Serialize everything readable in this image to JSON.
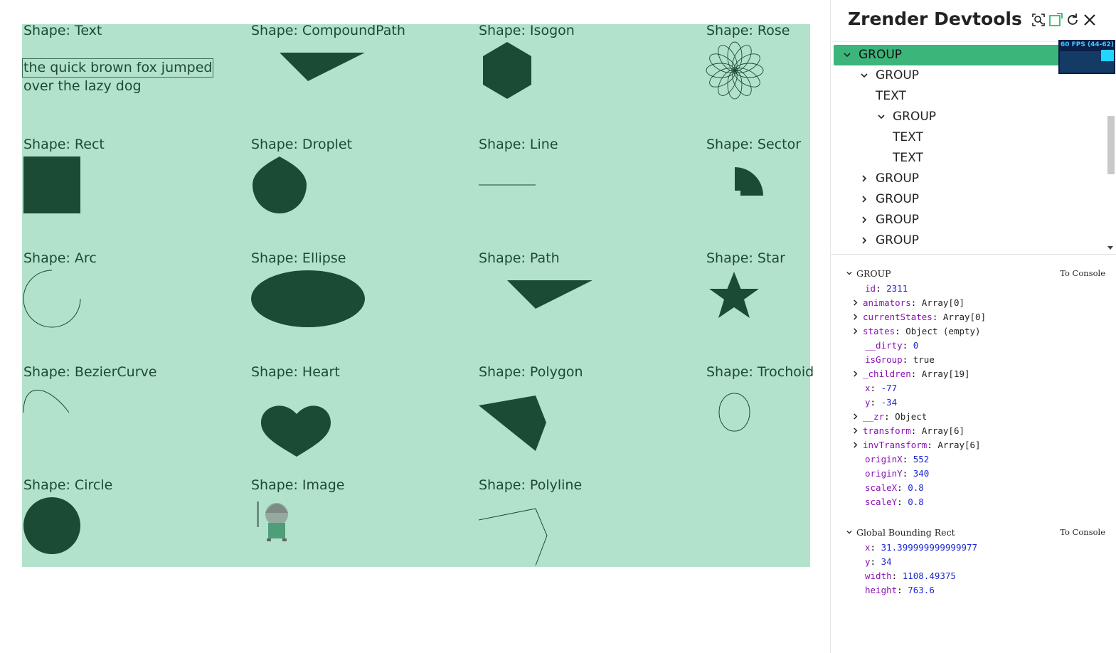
{
  "canvas": {
    "shapes": [
      {
        "label": "Shape: Text"
      },
      {
        "label": "Shape: CompoundPath"
      },
      {
        "label": "Shape: Isogon"
      },
      {
        "label": "Shape: Rose"
      },
      {
        "label": "Shape: Rect"
      },
      {
        "label": "Shape: Droplet"
      },
      {
        "label": "Shape: Line"
      },
      {
        "label": "Shape: Sector"
      },
      {
        "label": "Shape: Arc"
      },
      {
        "label": "Shape: Ellipse"
      },
      {
        "label": "Shape: Path"
      },
      {
        "label": "Shape: Star"
      },
      {
        "label": "Shape: BezierCurve"
      },
      {
        "label": "Shape: Heart"
      },
      {
        "label": "Shape: Polygon"
      },
      {
        "label": "Shape: Trochoid"
      },
      {
        "label": "Shape: Circle"
      },
      {
        "label": "Shape: Image"
      },
      {
        "label": "Shape: Polyline"
      }
    ],
    "text_shape": {
      "line1": "the quick brown fox jumped",
      "line2": "over the lazy dog"
    },
    "colors": {
      "background": "#b3e2cc",
      "fill": "#1b4a35"
    }
  },
  "devtools": {
    "title": "Zrender Devtools",
    "icons": [
      "inspect-icon",
      "new-window-icon",
      "refresh-icon",
      "close-icon"
    ],
    "fps": "60 FPS (44-62)",
    "tree": [
      {
        "label": "GROUP",
        "expanded": true,
        "selected": true
      },
      {
        "label": "GROUP",
        "expanded": true
      },
      {
        "label": "TEXT"
      },
      {
        "label": "GROUP",
        "expanded": true
      },
      {
        "label": "TEXT"
      },
      {
        "label": "TEXT"
      },
      {
        "label": "GROUP",
        "expanded": false
      },
      {
        "label": "GROUP",
        "expanded": false
      },
      {
        "label": "GROUP",
        "expanded": false
      },
      {
        "label": "GROUP",
        "expanded": false
      }
    ],
    "group_props": {
      "title": "GROUP",
      "to_console": "To Console",
      "rows": [
        {
          "key": "id",
          "value": "2311",
          "kind": "num"
        },
        {
          "key": "animators",
          "value": "Array[0]",
          "kind": "obj",
          "expandable": true
        },
        {
          "key": "currentStates",
          "value": "Array[0]",
          "kind": "obj",
          "expandable": true
        },
        {
          "key": "states",
          "value": "Object (empty)",
          "kind": "obj",
          "expandable": true
        },
        {
          "key": "__dirty",
          "value": "0",
          "kind": "num"
        },
        {
          "key": "isGroup",
          "value": "true",
          "kind": "bool"
        },
        {
          "key": "_children",
          "value": "Array[19]",
          "kind": "obj",
          "expandable": true
        },
        {
          "key": "x",
          "value": "-77",
          "kind": "num"
        },
        {
          "key": "y",
          "value": "-34",
          "kind": "num"
        },
        {
          "key": "__zr",
          "value": "Object",
          "kind": "obj",
          "expandable": true
        },
        {
          "key": "transform",
          "value": "Array[6]",
          "kind": "obj",
          "expandable": true
        },
        {
          "key": "invTransform",
          "value": "Array[6]",
          "kind": "obj",
          "expandable": true
        },
        {
          "key": "originX",
          "value": "552",
          "kind": "num"
        },
        {
          "key": "originY",
          "value": "340",
          "kind": "num"
        },
        {
          "key": "scaleX",
          "value": "0.8",
          "kind": "num"
        },
        {
          "key": "scaleY",
          "value": "0.8",
          "kind": "num"
        }
      ]
    },
    "bounding_rect": {
      "title": "Global Bounding Rect",
      "to_console": "To Console",
      "rows": [
        {
          "key": "x",
          "value": "31.399999999999977"
        },
        {
          "key": "y",
          "value": "34"
        },
        {
          "key": "width",
          "value": "1108.49375"
        },
        {
          "key": "height",
          "value": "763.6"
        }
      ]
    }
  }
}
